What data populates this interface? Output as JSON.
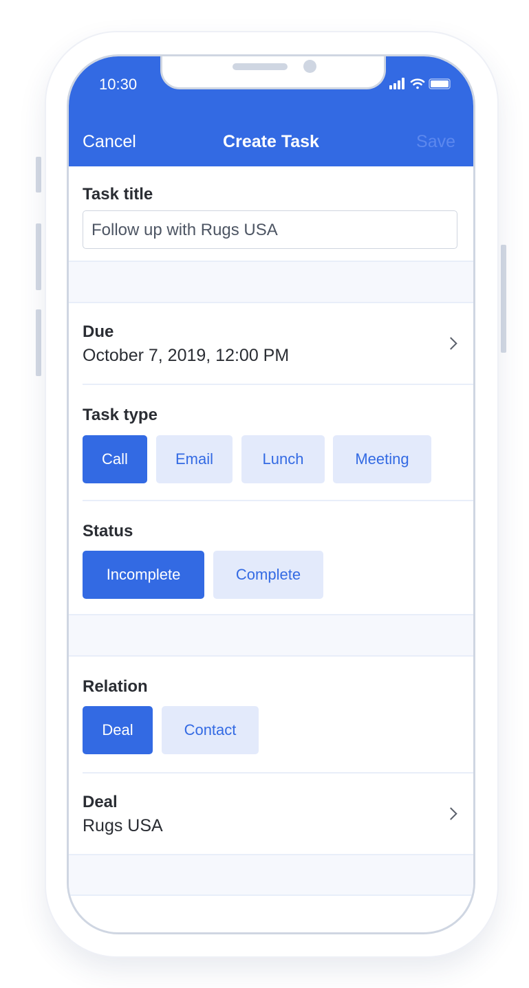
{
  "status_bar": {
    "time": "10:30"
  },
  "nav": {
    "cancel": "Cancel",
    "title": "Create Task",
    "save": "Save"
  },
  "task_title": {
    "label": "Task title",
    "value": "Follow up with Rugs USA"
  },
  "due": {
    "label": "Due",
    "value": "October 7, 2019, 12:00 PM"
  },
  "task_type": {
    "label": "Task type",
    "options": [
      "Call",
      "Email",
      "Lunch",
      "Meeting"
    ],
    "selected": "Call"
  },
  "status": {
    "label": "Status",
    "options": [
      "Incomplete",
      "Complete"
    ],
    "selected": "Incomplete"
  },
  "relation": {
    "label": "Relation",
    "options": [
      "Deal",
      "Contact"
    ],
    "selected": "Deal"
  },
  "deal": {
    "label": "Deal",
    "value": "Rugs USA"
  },
  "colors": {
    "accent": "#336ae3",
    "pill_inactive": "#e3eafb",
    "save_disabled": "#5c88ee"
  }
}
